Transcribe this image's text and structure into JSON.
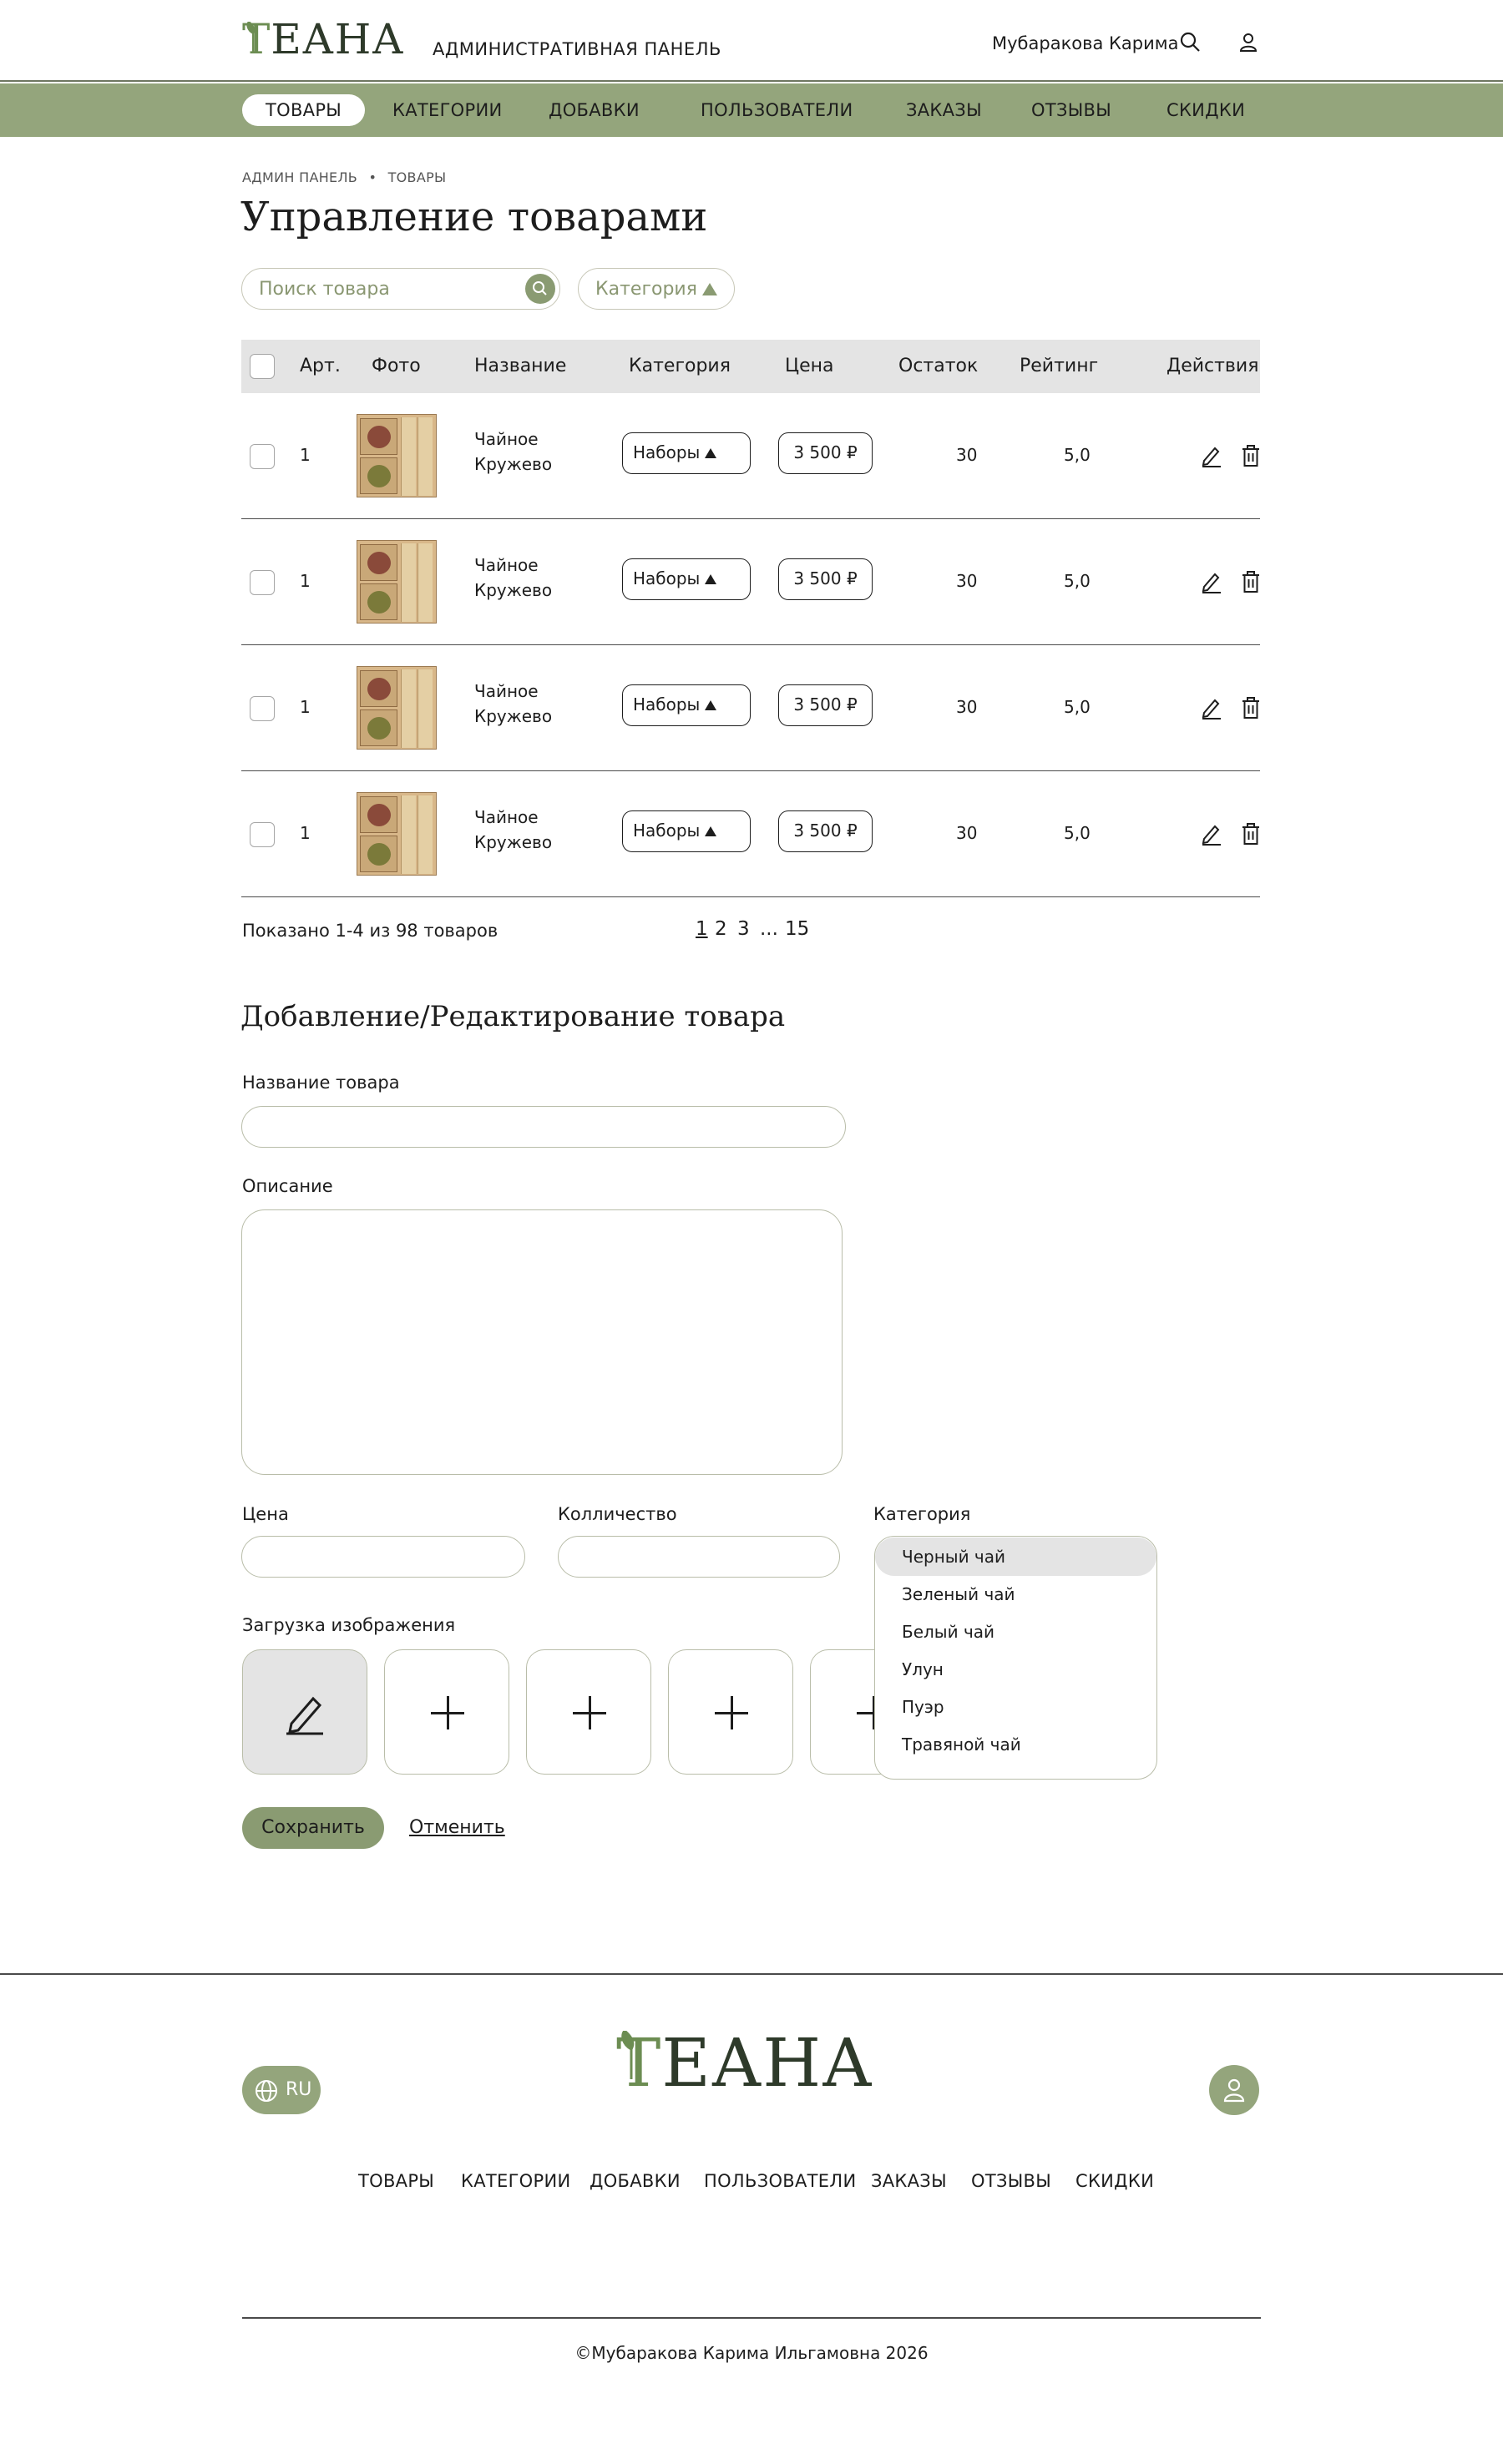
{
  "header": {
    "logo_first": "Т",
    "logo_rest": "ЕАНА",
    "admin_label": "АДМИНИСТРАТИВНАЯ ПАНЕЛЬ",
    "user_name": "Мубаракова Карима"
  },
  "nav": {
    "items": [
      "ТОВАРЫ",
      "КАТЕГОРИИ",
      "ДОБАВКИ",
      "ПОЛЬЗОВАТЕЛИ",
      "ЗАКАЗЫ",
      "ОТЗЫВЫ",
      "СКИДКИ"
    ]
  },
  "breadcrumb": {
    "root": "АДМИН ПАНЕЛЬ",
    "separator": "•",
    "current": "ТОВАРЫ"
  },
  "page_title": "Управление товарами",
  "search": {
    "placeholder": "Поиск товара"
  },
  "category_filter": {
    "label": "Категория"
  },
  "table": {
    "headers": {
      "art": "Арт.",
      "photo": "Фото",
      "name": "Название",
      "category": "Категория",
      "price": "Цена",
      "stock": "Остаток",
      "rating": "Рейтинг",
      "actions": "Действия"
    },
    "rows": [
      {
        "art": "1",
        "name_line1": "Чайное",
        "name_line2": "Кружево",
        "category": "Наборы",
        "price": "3 500 ₽",
        "stock": "30",
        "rating": "5,0"
      },
      {
        "art": "1",
        "name_line1": "Чайное",
        "name_line2": "Кружево",
        "category": "Наборы",
        "price": "3 500 ₽",
        "stock": "30",
        "rating": "5,0"
      },
      {
        "art": "1",
        "name_line1": "Чайное",
        "name_line2": "Кружево",
        "category": "Наборы",
        "price": "3 500 ₽",
        "stock": "30",
        "rating": "5,0"
      },
      {
        "art": "1",
        "name_line1": "Чайное",
        "name_line2": "Кружево",
        "category": "Наборы",
        "price": "3 500 ₽",
        "stock": "30",
        "rating": "5,0"
      }
    ]
  },
  "pagination": {
    "showing": "Показано 1-4 из 98 товаров",
    "pages": [
      "1",
      "2",
      "3",
      "...",
      "15"
    ]
  },
  "form": {
    "title": "Добавление/Редактирование товара",
    "name_label": "Название товара",
    "description_label": "Описание",
    "price_label": "Цена",
    "quantity_label": "Колличество",
    "category_label": "Категория",
    "upload_label": "Загрузка изображения",
    "category_options": [
      "Черный чай",
      "Зеленый чай",
      "Белый чай",
      "Улун",
      "Пуэр",
      "Травяной чай"
    ],
    "save_label": "Сохранить",
    "cancel_label": "Отменить"
  },
  "footer": {
    "lang": "RU",
    "logo_first": "Т",
    "logo_rest": "ЕАНА",
    "nav": [
      "ТОВАРЫ",
      "КАТЕГОРИИ",
      "ДОБАВКИ",
      "ПОЛЬЗОВАТЕЛИ",
      "ЗАКАЗЫ",
      "ОТЗЫВЫ",
      "СКИДКИ"
    ],
    "copyright": "©Мубаракова Карима Ильгамовна 2026"
  },
  "colors": {
    "accent": "#94a57c",
    "accent_dark": "#8a9b72",
    "logo_green": "#6c8d52",
    "header_gray": "#e4e4e4"
  }
}
